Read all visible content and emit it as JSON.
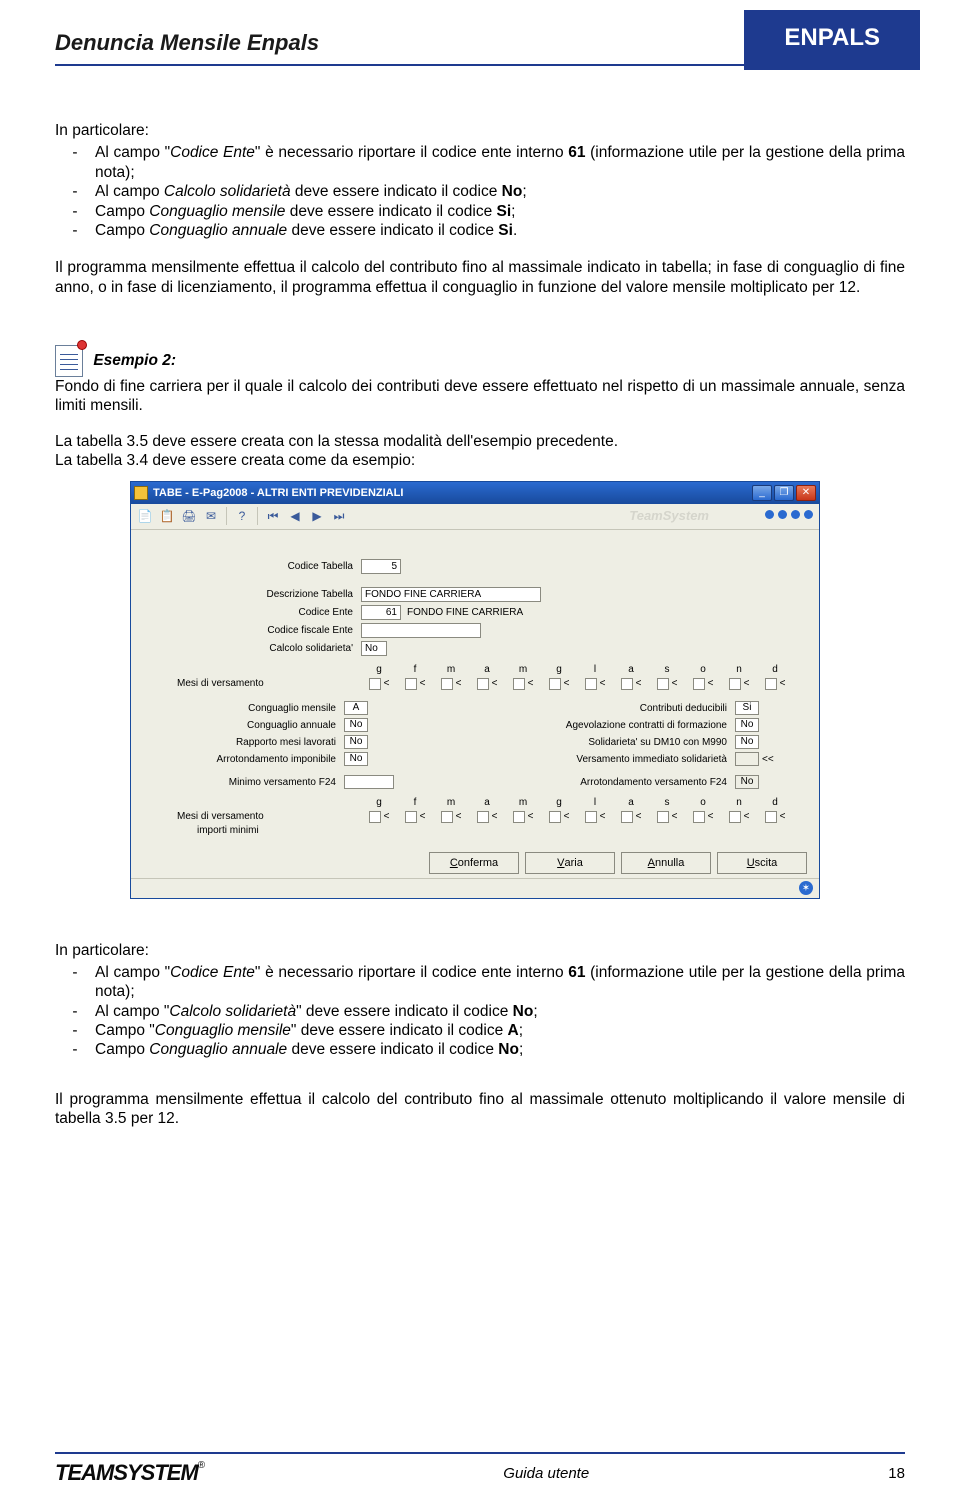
{
  "header": {
    "doc_title": "Denuncia Mensile Enpals",
    "badge": "ENPALS"
  },
  "block1": {
    "intro": "In particolare:",
    "b1_pre": "Al campo \"",
    "b1_it": "Codice Ente",
    "b1_mid": "\" è necessario riportare il codice ente interno ",
    "b1_bold": "61",
    "b1_post": " (informazione utile per la gestione della prima nota);",
    "b2_pre": "Al campo ",
    "b2_it": "Calcolo solidarietà",
    "b2_mid": " deve essere indicato il codice ",
    "b2_bold": "No",
    "b2_post": ";",
    "b3_pre": "Campo ",
    "b3_it": "Conguaglio mensile",
    "b3_mid": " deve essere indicato il codice ",
    "b3_bold": "Si",
    "b3_post": ";",
    "b4_pre": "Campo ",
    "b4_it": "Conguaglio annuale",
    "b4_mid": " deve essere indicato il codice ",
    "b4_bold": "Si",
    "b4_post": "."
  },
  "para1": "Il programma mensilmente effettua il calcolo del contributo fino al massimale indicato in tabella; in fase di conguaglio di fine anno, o in fase di licenziamento, il programma effettua il conguaglio in funzione del valore mensile moltiplicato per 12.",
  "esempio": {
    "label": "Esempio 2:",
    "body": "Fondo di fine carriera per il quale il calcolo dei contributi deve essere effettuato nel rispetto di un massimale annuale, senza limiti mensili.",
    "l1": "La tabella 3.5 deve essere creata con la stessa modalità dell'esempio precedente.",
    "l2": "La tabella 3.4 deve essere creata come da esempio:"
  },
  "window": {
    "title": "TABE  - E-Pag2008  -  ALTRI ENTI PREVIDENZIALI",
    "brand": "TeamSystem",
    "labels": {
      "codice_tabella": "Codice Tabella",
      "descrizione": "Descrizione Tabella",
      "codice_ente": "Codice Ente",
      "codice_fiscale": "Codice fiscale Ente",
      "calcolo_sol": "Calcolo solidarieta'",
      "mesi_vers": "Mesi di versamento",
      "cong_mensile": "Conguaglio mensile",
      "cong_annuale": "Conguaglio annuale",
      "rapporto": "Rapporto mesi lavorati",
      "arrot_imp": "Arrotondamento imponibile",
      "contrib_ded": "Contributi deducibili",
      "agev": "Agevolazione contratti di formazione",
      "sol_dm10": "Solidarieta' su DM10 con M990",
      "vers_imm": "Versamento immediato solidarietà",
      "min_f24": "Minimo versamento F24",
      "arr_f24": "Arrotondamento versamento F24",
      "importi_min": "importi minimi"
    },
    "values": {
      "codice_tabella": "5",
      "descrizione": "FONDO FINE CARRIERA",
      "codice_ente": "61",
      "codice_ente_desc": "FONDO FINE CARRIERA",
      "calcolo_sol": "No",
      "cong_mensile": "A",
      "cong_annuale": "No",
      "rapporto": "No",
      "arrot_imp": "No",
      "contrib_ded": "Si",
      "agev": "No",
      "sol_dm10": "No",
      "vers_imm": "<<",
      "arr_f24": "No"
    },
    "months": {
      "m1": "g",
      "m2": "f",
      "m3": "m",
      "m4": "a",
      "m5": "m",
      "m6": "g",
      "m7": "l",
      "m8": "a",
      "m9": "s",
      "m10": "o",
      "m11": "n",
      "m12": "d"
    },
    "buttons": {
      "conferma": "Conferma",
      "varia": "Varia",
      "annulla": "Annulla",
      "uscita": "Uscita"
    }
  },
  "block2": {
    "intro": "In particolare:",
    "b1_pre": "Al campo \"",
    "b1_it": "Codice Ente",
    "b1_mid": "\" è necessario riportare il codice ente interno ",
    "b1_bold": "61",
    "b1_post": " (informazione utile per la gestione della prima nota);",
    "b2_pre": "Al campo \"",
    "b2_it": "Calcolo solidarietà",
    "b2_mid": "\" deve essere indicato il codice ",
    "b2_bold": "No",
    "b2_post": ";",
    "b3_pre": "Campo \"",
    "b3_it": "Conguaglio mensile",
    "b3_mid": "\" deve essere indicato il codice ",
    "b3_bold": "A",
    "b3_post": ";",
    "b4_pre": "Campo ",
    "b4_it": "Conguaglio annuale",
    "b4_mid": " deve essere indicato il codice ",
    "b4_bold": "No",
    "b4_post": ";"
  },
  "para2": "Il programma mensilmente effettua il calcolo del contributo fino al massimale ottenuto moltiplicando il valore mensile di tabella 3.5 per 12.",
  "footer": {
    "logo": "TEAMSYSTEM",
    "center": "Guida utente",
    "page": "18"
  }
}
